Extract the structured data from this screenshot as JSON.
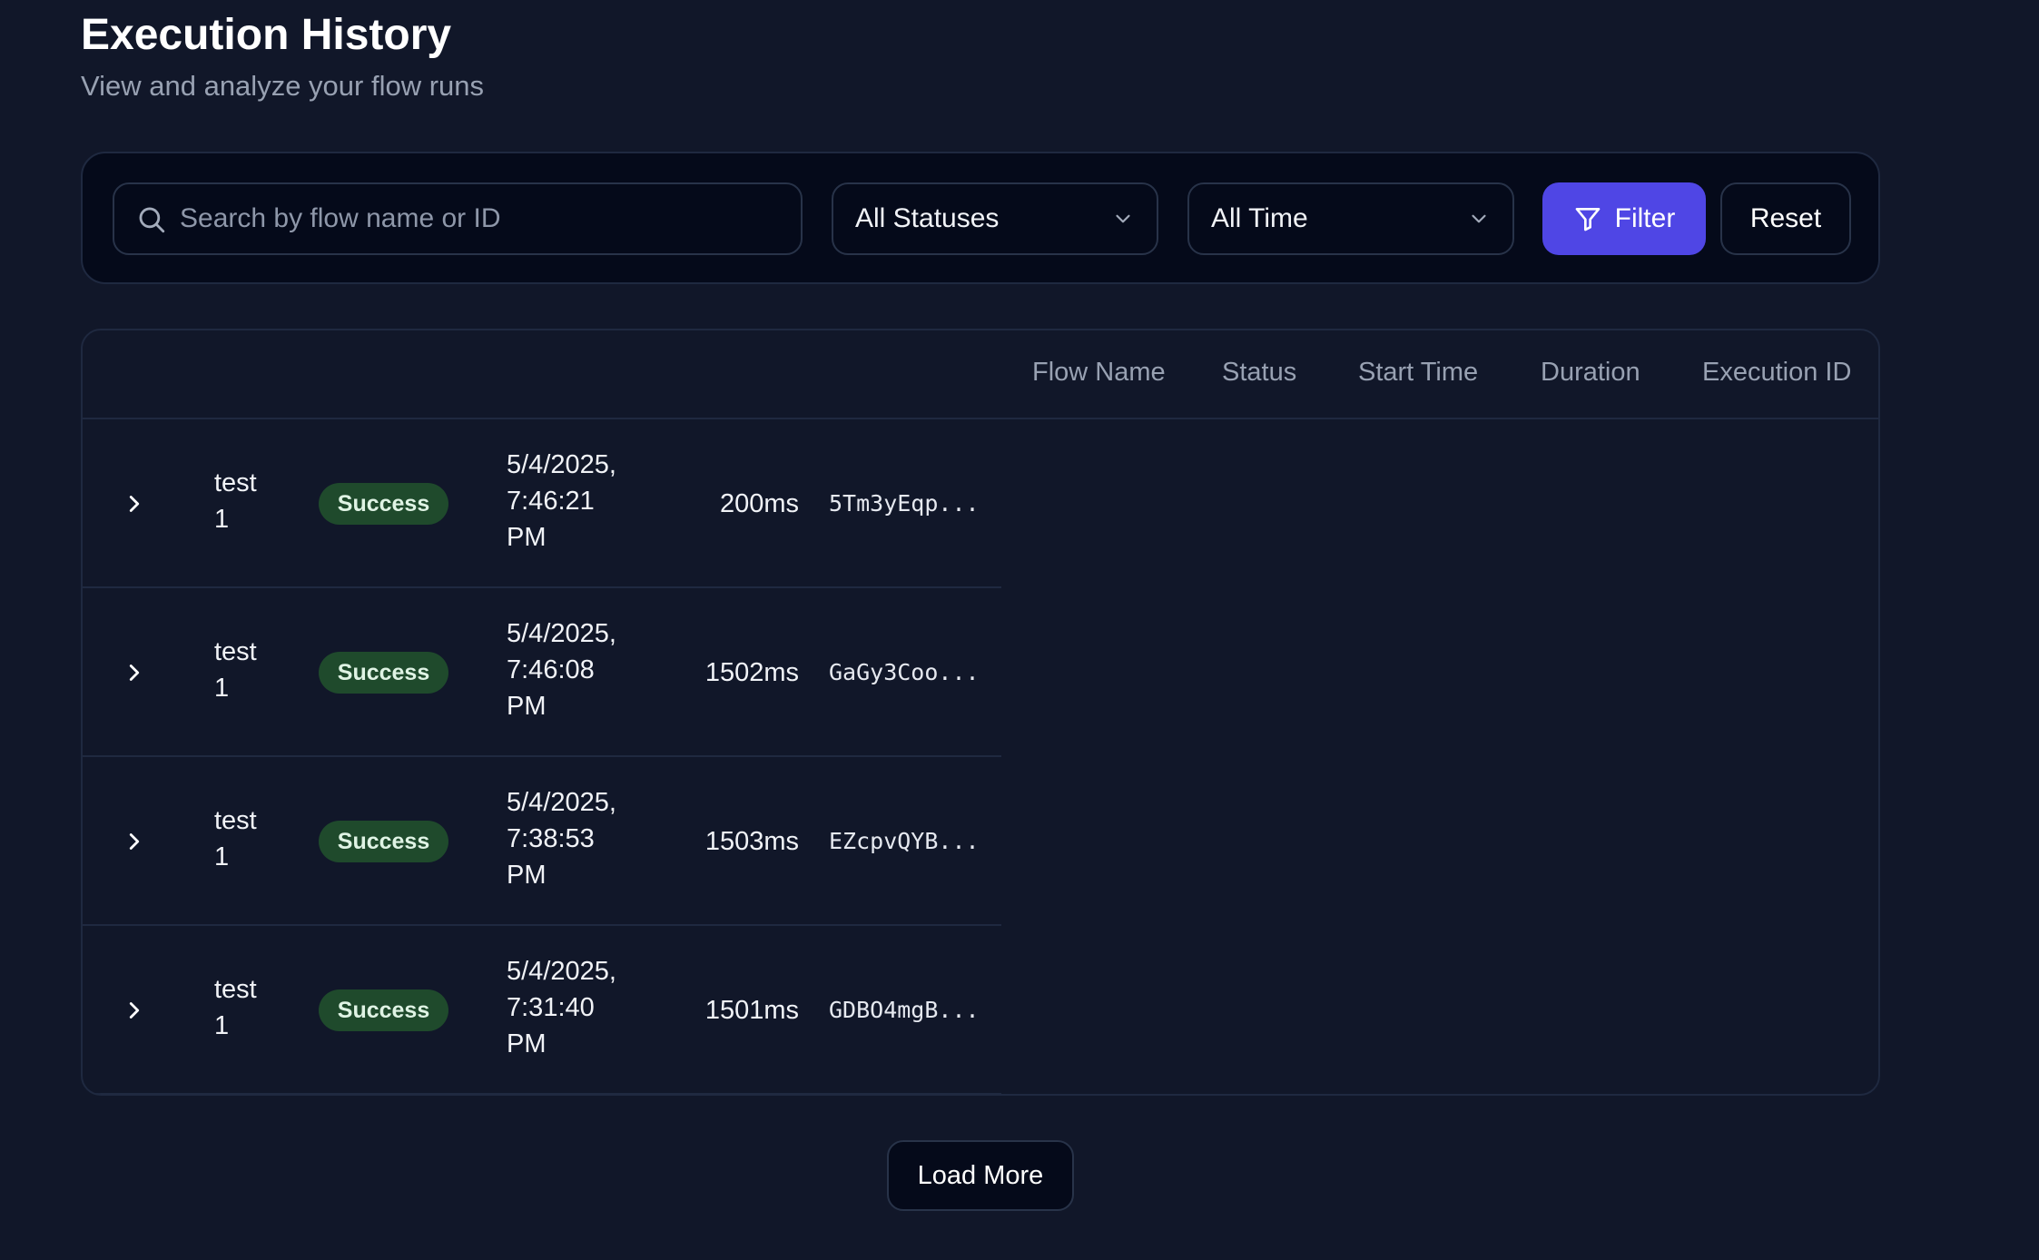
{
  "header": {
    "title": "Execution History",
    "subtitle": "View and analyze your flow runs"
  },
  "filters": {
    "search_placeholder": "Search by flow name or ID",
    "status_value": "All Statuses",
    "time_value": "All Time",
    "filter_label": "Filter",
    "reset_label": "Reset"
  },
  "table": {
    "columns": [
      "Flow Name",
      "Status",
      "Start Time",
      "Duration",
      "Execution ID"
    ],
    "rows": [
      {
        "flow_name": "test 1",
        "status": "Success",
        "start_time": "5/4/2025, 7:46:21 PM",
        "duration": "200ms",
        "execution_id": "5Tm3yEqp..."
      },
      {
        "flow_name": "test 1",
        "status": "Success",
        "start_time": "5/4/2025, 7:46:08 PM",
        "duration": "1502ms",
        "execution_id": "GaGy3Coo..."
      },
      {
        "flow_name": "test 1",
        "status": "Success",
        "start_time": "5/4/2025, 7:38:53 PM",
        "duration": "1503ms",
        "execution_id": "EZcpvQYB..."
      },
      {
        "flow_name": "test 1",
        "status": "Success",
        "start_time": "5/4/2025, 7:31:40 PM",
        "duration": "1501ms",
        "execution_id": "GDBO4mgB..."
      }
    ]
  },
  "load_more_label": "Load More",
  "colors": {
    "background": "#111729",
    "panel": "#050a1a",
    "accent": "#4f46e5",
    "success_badge": "#1f4a2c"
  },
  "icons": {
    "search": "search-icon",
    "dropdown": "chevron-down-icon",
    "filter": "funnel-icon",
    "expand": "chevron-right-icon"
  }
}
